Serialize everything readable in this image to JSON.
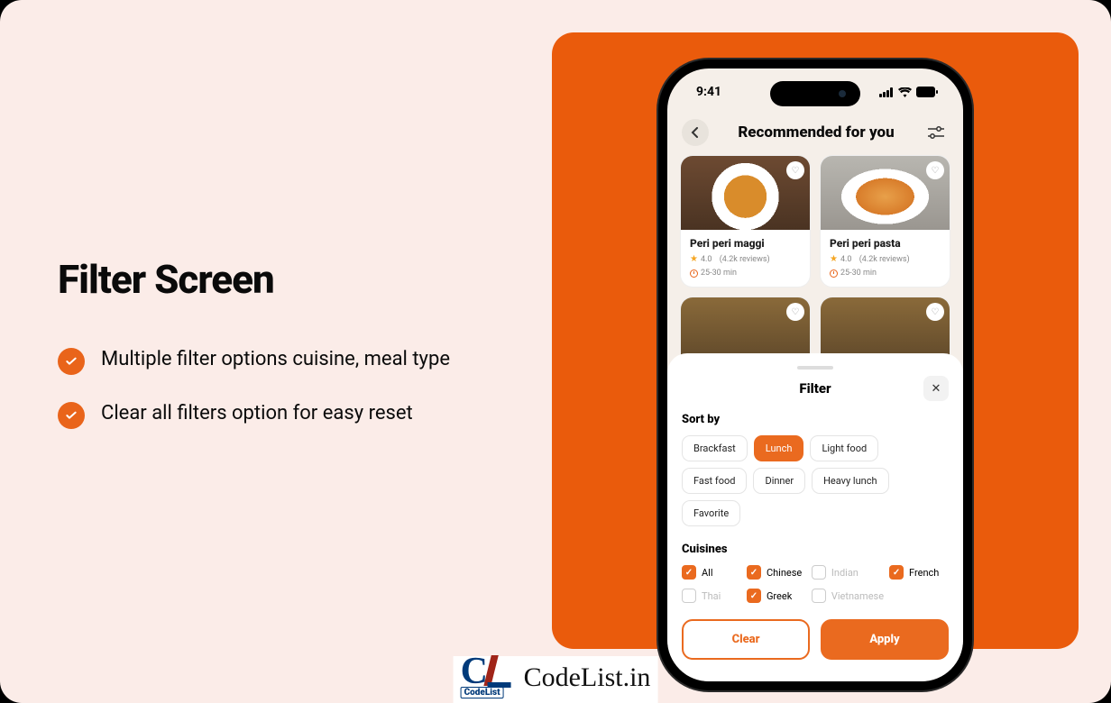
{
  "left": {
    "title": "Filter Screen",
    "bullets": [
      "Multiple filter options cuisine, meal type",
      "Clear all filters option for easy reset"
    ]
  },
  "phone": {
    "time": "9:41",
    "appbar_title": "Recommended for you",
    "cards": [
      {
        "title": "Peri peri maggi",
        "rating": "4.0",
        "reviews": "(4.2k reviews)",
        "time": "25-30 min"
      },
      {
        "title": "Peri peri pasta",
        "rating": "4.0",
        "reviews": "(4.2k reviews)",
        "time": "25-30 min"
      }
    ],
    "sheet": {
      "title": "Filter",
      "sort_label": "Sort by",
      "chips": [
        {
          "label": "Brackfast",
          "on": false
        },
        {
          "label": "Lunch",
          "on": true
        },
        {
          "label": "Light food",
          "on": false
        },
        {
          "label": "Fast food",
          "on": false
        },
        {
          "label": "Dinner",
          "on": false
        },
        {
          "label": "Heavy lunch",
          "on": false
        },
        {
          "label": "Favorite",
          "on": false
        }
      ],
      "cuisines_label": "Cuisines",
      "cuisines": [
        {
          "label": "All",
          "on": true,
          "dim": false
        },
        {
          "label": "Chinese",
          "on": true,
          "dim": false
        },
        {
          "label": "Indian",
          "on": false,
          "dim": true
        },
        {
          "label": "French",
          "on": true,
          "dim": false
        },
        {
          "label": "Thai",
          "on": false,
          "dim": true
        },
        {
          "label": "Greek",
          "on": true,
          "dim": false
        },
        {
          "label": "Vietnamese",
          "on": false,
          "dim": true
        }
      ],
      "clear": "Clear",
      "apply": "Apply"
    }
  },
  "logo": {
    "mark_sub": "CodeList",
    "text": "CodeList.in"
  }
}
